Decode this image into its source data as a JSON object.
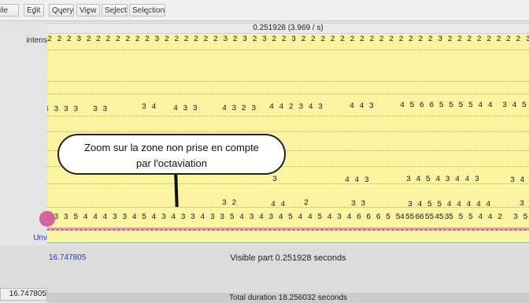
{
  "menu": {
    "items": [
      "ile",
      "Edit",
      "Query",
      "View",
      "Select",
      "Selection"
    ]
  },
  "header": {
    "time_label": "0.251928 (3.969 / s)"
  },
  "tiers": {
    "top_label": "intens",
    "unv_label": "Unv"
  },
  "rows": {
    "row1": "2 2 2 3 2 2 2 2 2 2 2 3 2 2 2 2 2 2 3 2 3 2 3 2 2 3 2 2 2 2 2 2 2 2 2 2 2 2 2 2 3 2 2 2 2 2 2 2 2 3 2 2 2 2 2",
    "row2_a": "4 3 3 3",
    "row2_b": "3 3",
    "row2_c": "3 4",
    "row2_d": "4 3  3",
    "row2_e": "4 3 2 3",
    "row2_f": "4 4 2 3 4 3",
    "row2_g": "4 4 3",
    "row2_h": "4 5 6 6 5 5 5 5 4 4",
    "row2_i": "3 4 5",
    "row3_a": "3",
    "row3_b": "4 4 3",
    "row3_c": "3 4 5 4 3 4 4 3",
    "row3_d": "3 4",
    "row4_a": "3 2",
    "row4_b": "4 4",
    "row4_c": "2",
    "row4_d": "3 3",
    "row4_e": "3 4 5 5 4 4 4 4 4",
    "row4_f": "3",
    "row5": "5 3 3 5 4 4 4 3 3 4 5 4 3 4 3 3 4 3 3 5 4 3 4 3 4 5 4 4 5 4 3 4 6 6 6 5 5 5 6 5 4 3",
    "row5_b": "4 5 6 5 5 5 5 5 4 4 2",
    "row5_c": "3 5 6"
  },
  "callout": {
    "line1": "Zoom sur la zone non prise en compte",
    "line2": "par l'octaviation"
  },
  "footer": {
    "left_time": "16.747805",
    "blue_time": "16.747805",
    "visible_part": "Visible part 0.251928 seconds",
    "total_duration": "Total duration 18.256032 seconds"
  }
}
